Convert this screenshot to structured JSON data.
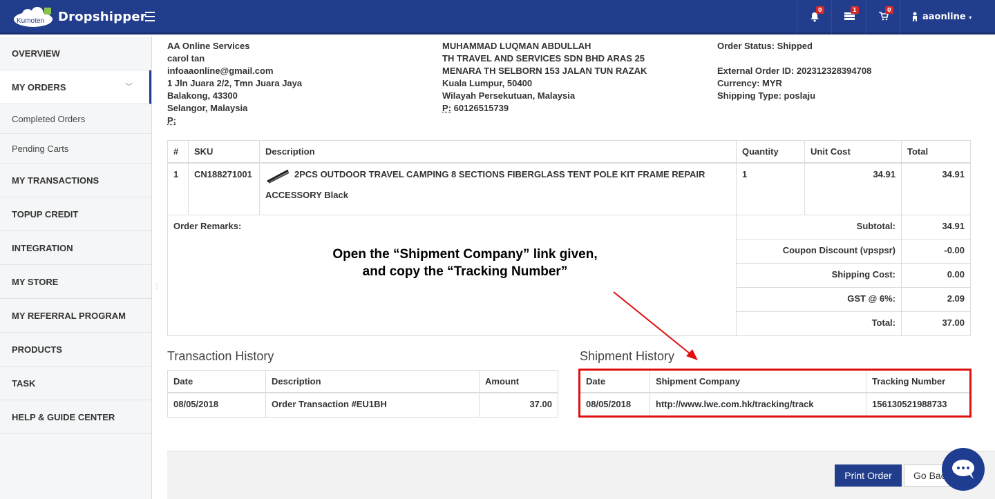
{
  "header": {
    "logo_text": "Kumoten",
    "brand": "Dropshipper",
    "notifications_count": "0",
    "messages_count": "1",
    "cart_count": "0",
    "username": "aaonline"
  },
  "sidebar": {
    "items": [
      {
        "label": "OVERVIEW"
      },
      {
        "label": "MY ORDERS"
      },
      {
        "label": "MY TRANSACTIONS"
      },
      {
        "label": "TOPUP CREDIT"
      },
      {
        "label": "INTEGRATION"
      },
      {
        "label": "MY STORE"
      },
      {
        "label": "MY REFERRAL PROGRAM"
      },
      {
        "label": "PRODUCTS"
      },
      {
        "label": "TASK"
      },
      {
        "label": "HELP & GUIDE CENTER"
      }
    ],
    "sub_items": [
      {
        "label": "Completed Orders"
      },
      {
        "label": "Pending Carts"
      }
    ]
  },
  "seller": {
    "company": "AA Online Services",
    "name": "carol tan",
    "email": "infoaaonline@gmail.com",
    "address1": "1 Jln Juara 2/2, Tmn Juara Jaya",
    "address2": "Balakong, 43300",
    "address3": "Selangor, Malaysia",
    "phone_label": "P:"
  },
  "recipient": {
    "name": "MUHAMMAD LUQMAN ABDULLAH",
    "line1": "TH TRAVEL AND SERVICES SDN BHD ARAS 25",
    "line2": "MENARA TH SELBORN 153 JALAN TUN RAZAK",
    "line3": "Kuala Lumpur, 50400",
    "line4": "Wilayah Persekutuan, Malaysia",
    "phone_label": "P:",
    "phone": " 60126515739"
  },
  "order_info": {
    "status": "Order Status: Shipped",
    "external_id": "External Order ID: 202312328394708",
    "currency": "Currency: MYR",
    "shipping_type": "Shipping Type: poslaju"
  },
  "order_table": {
    "headers": [
      "#",
      "SKU",
      "Description",
      "Quantity",
      "Unit Cost",
      "Total"
    ],
    "row": {
      "index": "1",
      "sku": "CN188271001",
      "desc1": "2PCS OUTDOOR TRAVEL CAMPING 8 SECTIONS FIBERGLASS TENT POLE KIT FRAME REPAIR",
      "desc2": "ACCESSORY Black",
      "quantity": "1",
      "unit_cost": "34.91",
      "total": "34.91"
    },
    "remarks_label": "Order Remarks:",
    "summary": [
      {
        "label": "Subtotal:",
        "value": "34.91"
      },
      {
        "label": "Coupon Discount (vpspsr)",
        "value": "-0.00"
      },
      {
        "label": "Shipping Cost:",
        "value": "0.00"
      },
      {
        "label": "GST @ 6%:",
        "value": "2.09"
      },
      {
        "label": "Total:",
        "value": "37.00"
      }
    ]
  },
  "annotation": {
    "line1": "Open the “Shipment Company” link given,",
    "line2": "and copy the “Tracking Number”"
  },
  "transaction_history": {
    "title": "Transaction History",
    "headers": [
      "Date",
      "Description",
      "Amount"
    ],
    "row": {
      "date": "08/05/2018",
      "description": "Order Transaction #EU1BH",
      "amount": "37.00"
    }
  },
  "shipment_history": {
    "title": "Shipment History",
    "headers": [
      "Date",
      "Shipment Company",
      "Tracking Number"
    ],
    "row": {
      "date": "08/05/2018",
      "company": "http://www.lwe.com.hk/tracking/track",
      "tracking": "156130521988733"
    }
  },
  "actions": {
    "print": "Print Order",
    "back": "Go Back"
  },
  "colors": {
    "brand": "#223d8c",
    "highlight": "#e01010"
  }
}
